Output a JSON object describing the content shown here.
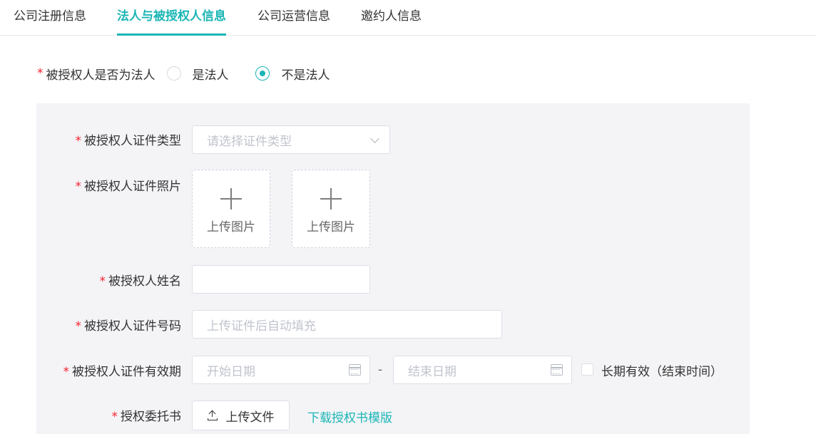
{
  "tabs": [
    {
      "label": "公司注册信息",
      "active": false
    },
    {
      "label": "法人与被授权人信息",
      "active": true
    },
    {
      "label": "公司运营信息",
      "active": false
    },
    {
      "label": "邀约人信息",
      "active": false
    }
  ],
  "required_mark": "*",
  "authorized_is_legal": {
    "label": "被授权人是否为法人",
    "options": [
      {
        "label": "是法人",
        "checked": false
      },
      {
        "label": "不是法人",
        "checked": true
      }
    ]
  },
  "form": {
    "cert_type": {
      "label": "被授权人证件类型",
      "placeholder": "请选择证件类型"
    },
    "cert_photo": {
      "label": "被授权人证件照片",
      "upload_front": "上传图片",
      "upload_back": "上传图片"
    },
    "name": {
      "label": "被授权人姓名",
      "value": ""
    },
    "cert_number": {
      "label": "被授权人证件号码",
      "placeholder": "上传证件后自动填充"
    },
    "validity": {
      "label": "被授权人证件有效期",
      "start_placeholder": "开始日期",
      "separator": "-",
      "end_placeholder": "结束日期",
      "long_term_label": "长期有效（结束时间）",
      "long_term_checked": false
    },
    "authorization_letter": {
      "label": "授权委托书",
      "upload_button": "上传文件",
      "download_link": "下载授权书模版"
    }
  },
  "colors": {
    "accent": "#1bb5b5",
    "required": "#f5222d",
    "panel_bg": "#f4f4f7"
  }
}
